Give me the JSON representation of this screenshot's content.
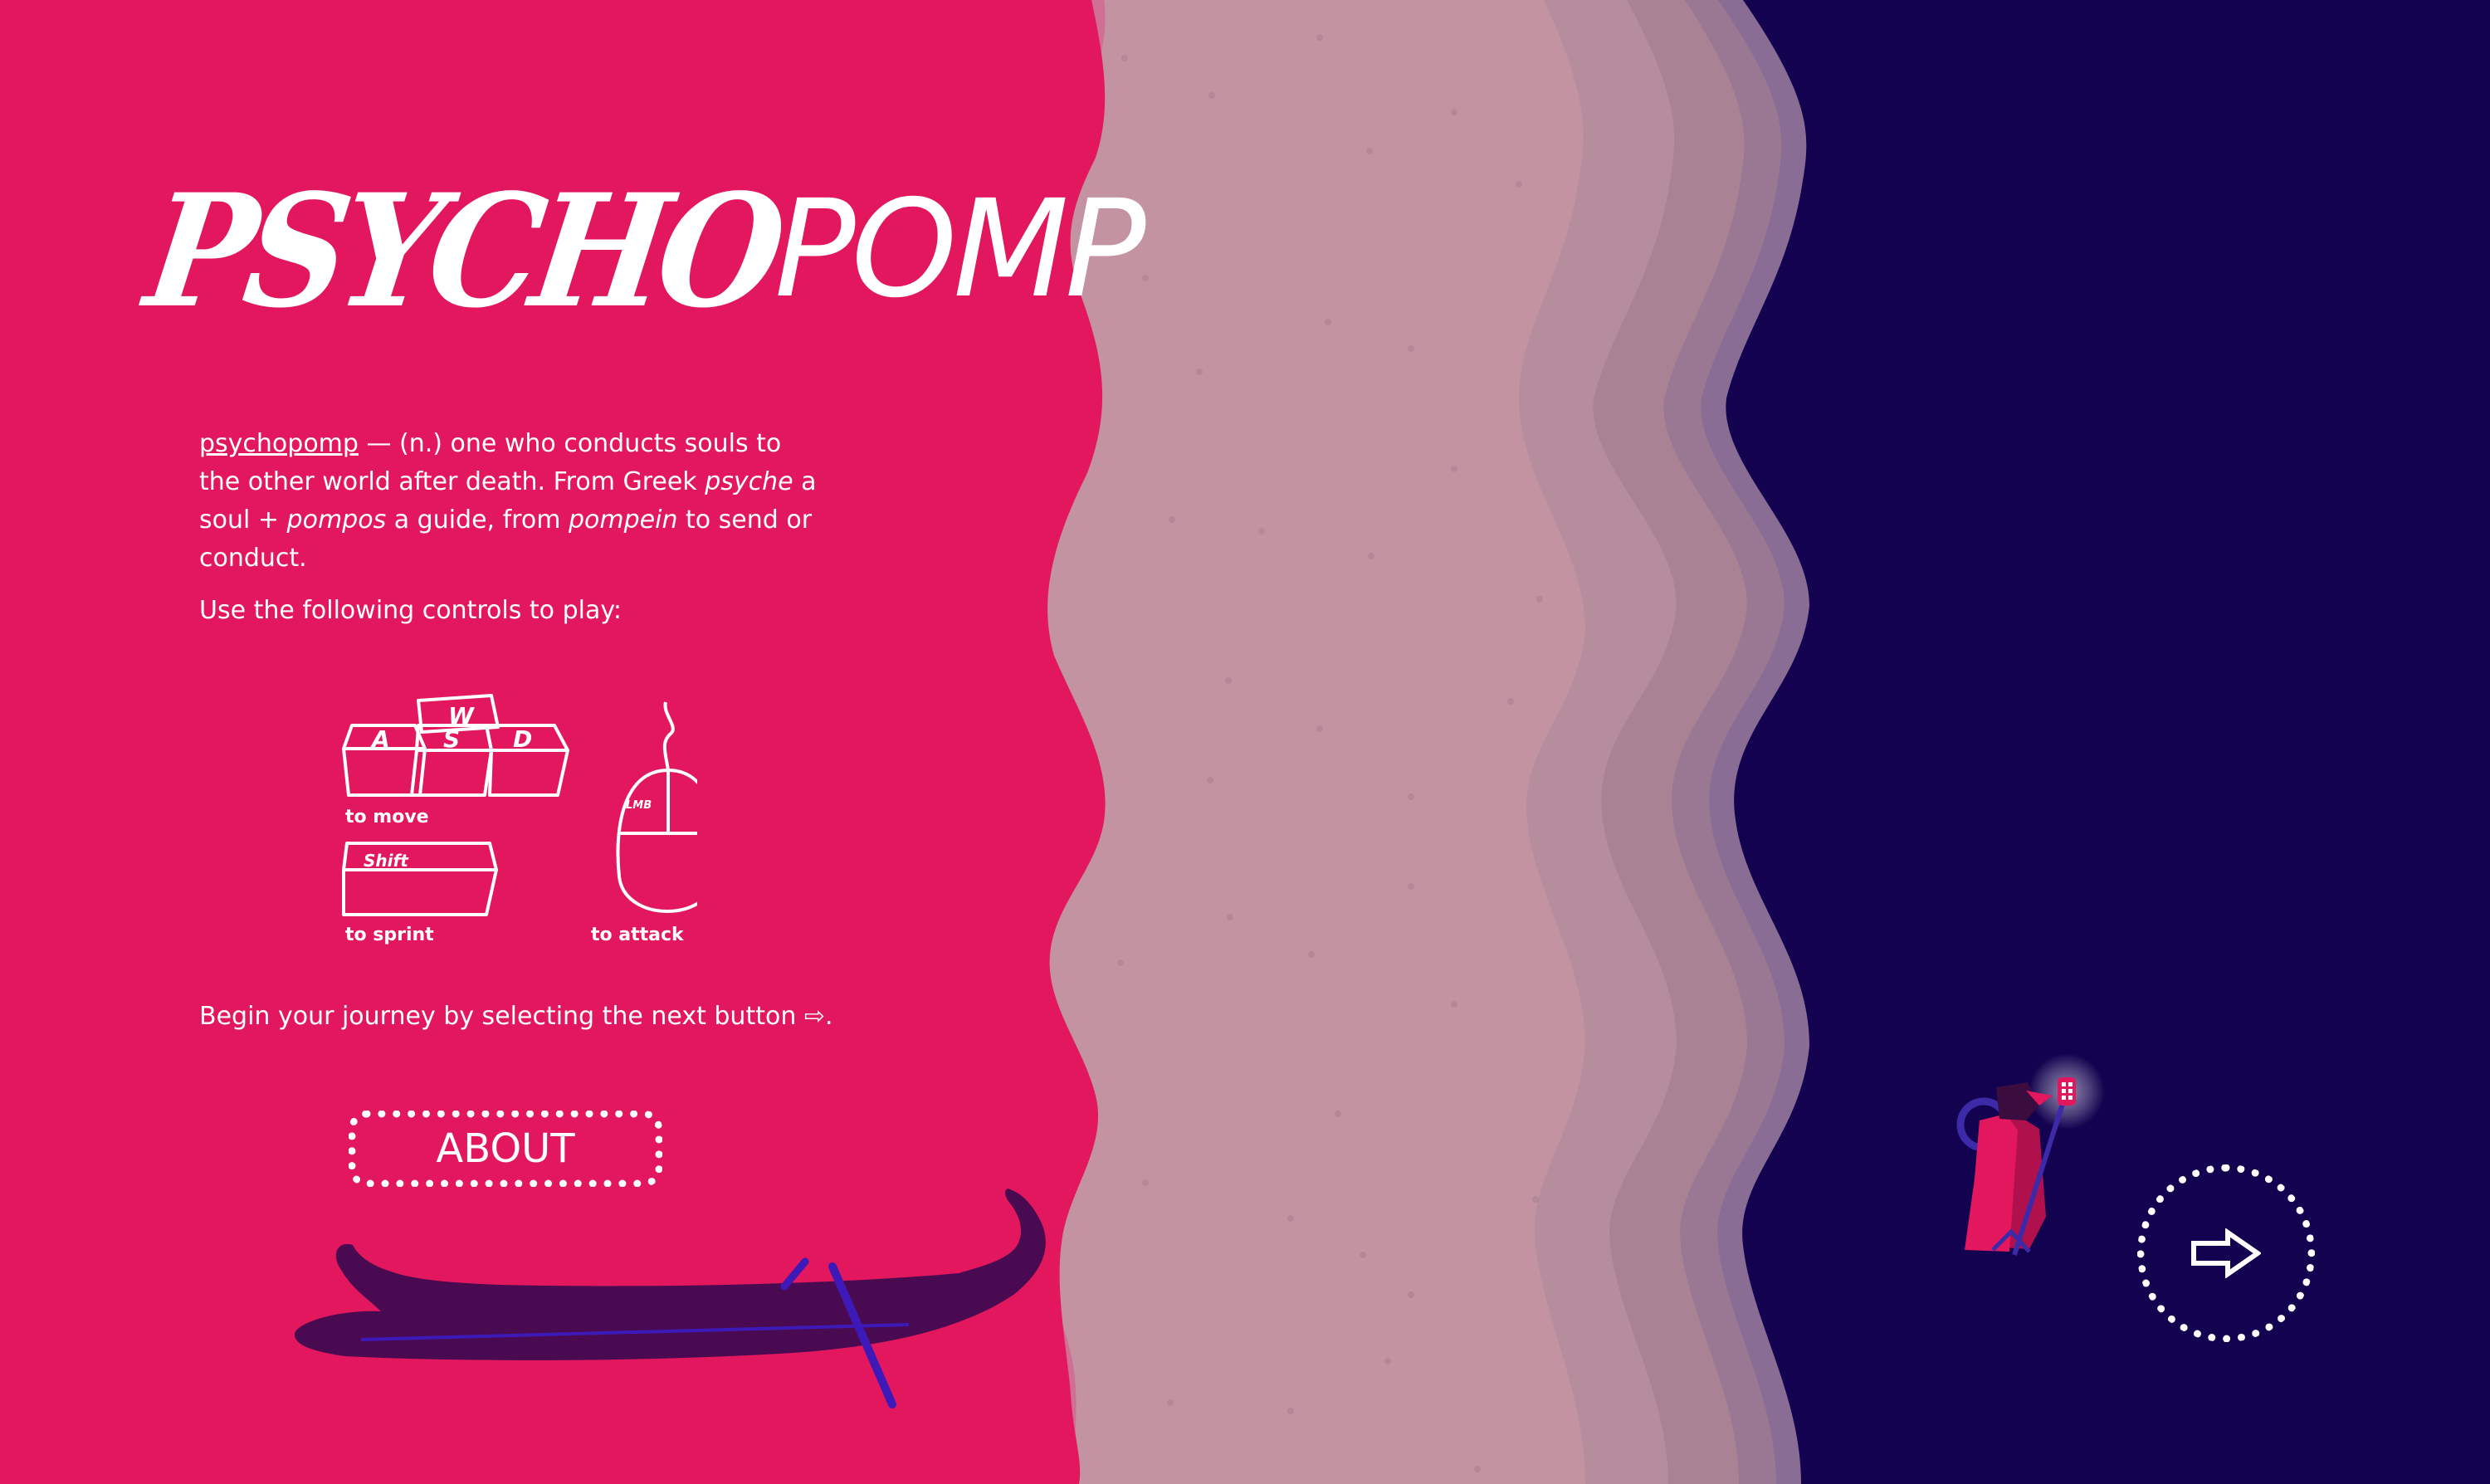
{
  "title": {
    "part1": "PSYCHO",
    "part2": "POMP"
  },
  "definition": {
    "term": "psychopomp",
    "seg1": " — (n.) one who conducts souls to the other world after death. From Greek ",
    "word1": "psyche",
    "seg2": " a soul + ",
    "word2": "pompos",
    "seg3": " a guide, from ",
    "word3": "pompein",
    "seg4": " to send or conduct."
  },
  "controls_intro": "Use the following controls to play:",
  "controls": {
    "keys": [
      "W",
      "A",
      "S",
      "D"
    ],
    "move_label": "to move",
    "shift_key": "Shift",
    "sprint_label": "to sprint",
    "mouse_key": "LMB",
    "attack_label": "to attack"
  },
  "begin_text": "Begin your journey by selecting the next button ⇨.",
  "about_label": "ABOUT",
  "next_button": {
    "icon": "right-arrow-icon"
  },
  "colors": {
    "land": "#e2175e",
    "beach": "#c493a1",
    "shallows": [
      "#cf8ca3",
      "#b68d9d",
      "#a98394",
      "#9a7893",
      "#8a6d94"
    ],
    "sea": "#12024f",
    "boat": "#4a0a52",
    "oar": "#3d1ab8"
  }
}
